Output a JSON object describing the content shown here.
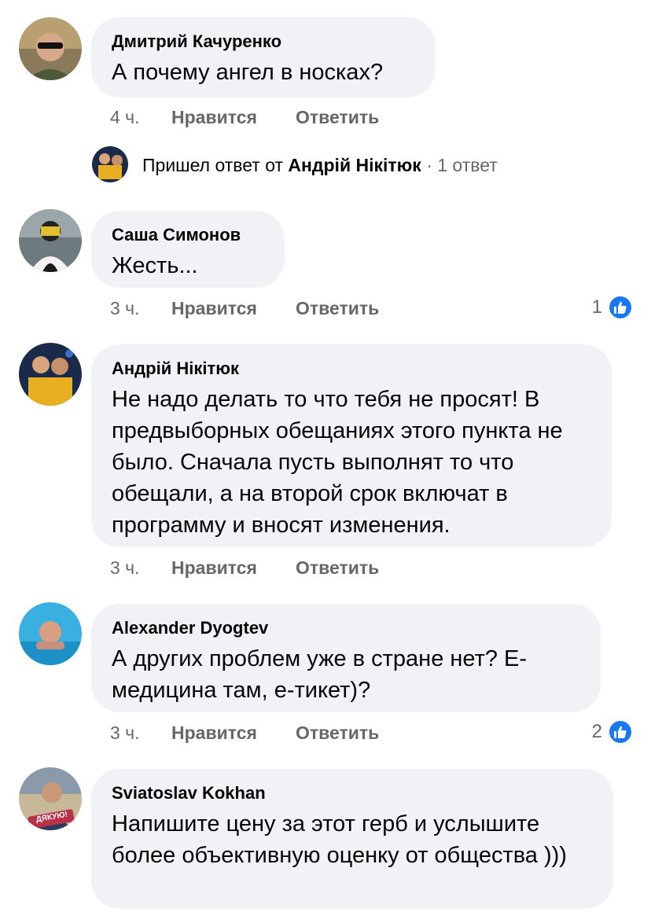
{
  "comments": [
    {
      "author": "Дмитрий Качуренко",
      "text": "А почему ангел в носках?",
      "time": "4 ч.",
      "like_label": "Нравится",
      "reply_label": "Ответить"
    },
    {
      "author": "Саша Симонов",
      "text": "Жесть...",
      "time": "3 ч.",
      "like_label": "Нравится",
      "reply_label": "Ответить",
      "reaction_count": "1"
    },
    {
      "author": "Андрій Нікітюк",
      "text": "Не надо делать то что тебя не просят! В предвыборных обещаниях этого пункта не было. Сначала пусть выполнят то что обещали, а на второй срок включат в программу и вносят изменения.",
      "time": "3 ч.",
      "like_label": "Нравится",
      "reply_label": "Ответить"
    },
    {
      "author": "Alexander Dyogtev",
      "text": "А других проблем уже в стране нет? Е-медицина там, е-тикет)?",
      "time": "3 ч.",
      "like_label": "Нравится",
      "reply_label": "Ответить",
      "reaction_count": "2"
    },
    {
      "author": "Sviatoslav Kokhan",
      "text": "Напишите цену за этот герб и услышите более объективную оценку от общества )))",
      "avatar_badge": "ДЯКУЮ!"
    }
  ],
  "reply_summary": {
    "prefix": "Пришел ответ от",
    "author": "Андрій Нікітюк",
    "suffix": "· 1 ответ"
  },
  "colors": {
    "bubble": "#f0f2f5",
    "muted_text": "#65676b",
    "like_blue": "#1877f2"
  },
  "icons": {
    "reaction": "thumbs-up-icon"
  }
}
